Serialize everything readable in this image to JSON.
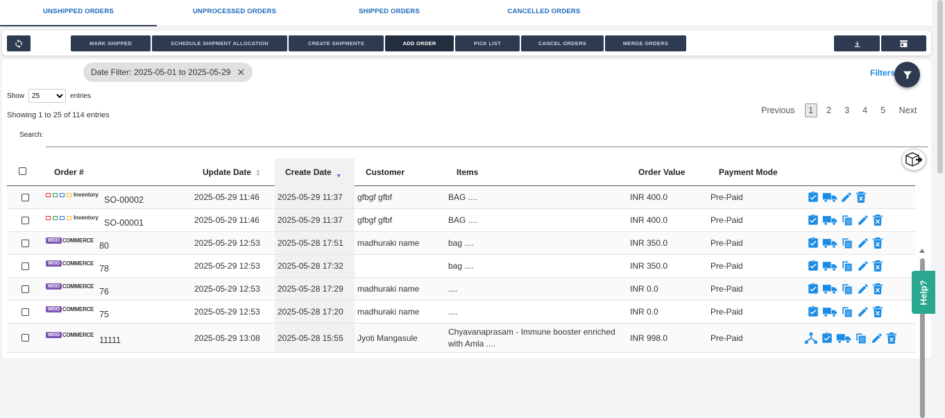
{
  "tabs": [
    {
      "label": "UNSHIPPED ORDERS",
      "active": true
    },
    {
      "label": "UNPROCESSED ORDERS",
      "active": false
    },
    {
      "label": "SHIPPED ORDERS",
      "active": false
    },
    {
      "label": "CANCELLED ORDERS",
      "active": false
    }
  ],
  "toolbar": {
    "refresh_icon": "refresh-icon",
    "buttons": [
      {
        "label": "MARK SHIPPED"
      },
      {
        "label": "SCHEDULE SHIPMENT ALLOCATION"
      },
      {
        "label": "CREATE SHIPMENTS"
      },
      {
        "label": "ADD ORDER"
      },
      {
        "label": "PICK LIST"
      },
      {
        "label": "CANCEL ORDERS"
      },
      {
        "label": "MERGE ORDERS"
      }
    ],
    "download_icon": "download-icon",
    "store_icon": "store-icon"
  },
  "filter": {
    "chip_text": "Date Filter: 2025-05-01 to 2025-05-29",
    "chip_close": "✕",
    "filters_label": "Filters"
  },
  "length": {
    "show": "Show",
    "value": "25",
    "entries": "entries",
    "options": [
      "25"
    ]
  },
  "info": "Showing 1 to 25 of 114 entries",
  "pager": {
    "previous": "Previous",
    "pages": [
      "1",
      "2",
      "3",
      "4",
      "5"
    ],
    "current": "1",
    "next": "Next"
  },
  "search": {
    "label": "Search:",
    "value": ""
  },
  "columns": {
    "order": "Order #",
    "update_date": "Update Date",
    "create_date": "Create Date",
    "customer": "Customer",
    "items": "Items",
    "order_value": "Order Value",
    "payment_mode": "Payment Mode"
  },
  "rows": [
    {
      "source": "inventory",
      "logo_text": "Inventory",
      "order": "SO-00002",
      "update": "2025-05-29 11:46",
      "create": "2025-05-29 11:37",
      "customer": "gfbgf gfbf",
      "items": "BAG ....",
      "value": "INR 400.0",
      "payment": "Pre-Paid",
      "actions": [
        "approve",
        "truck",
        "edit",
        "delete"
      ]
    },
    {
      "source": "inventory",
      "logo_text": "Inventory",
      "order": "SO-00001",
      "update": "2025-05-29 11:46",
      "create": "2025-05-29 11:37",
      "customer": "gfbgf gfbf",
      "items": "BAG ....",
      "value": "INR 400.0",
      "payment": "Pre-Paid",
      "actions": [
        "approve",
        "truck",
        "copy",
        "edit",
        "delete"
      ]
    },
    {
      "source": "woo",
      "logo_text": "WOOCOMMERCE",
      "order": "80",
      "update": "2025-05-29 12:53",
      "create": "2025-05-28 17:51",
      "customer": "madhuraki name",
      "items": "bag ....",
      "value": "INR 350.0",
      "payment": "Pre-Paid",
      "actions": [
        "approve",
        "truck",
        "copy",
        "edit",
        "delete"
      ]
    },
    {
      "source": "woo",
      "logo_text": "WOOCOMMERCE",
      "order": "78",
      "update": "2025-05-29 12:53",
      "create": "2025-05-28 17:32",
      "customer": "",
      "items": "bag ....",
      "value": "INR 350.0",
      "payment": "Pre-Paid",
      "actions": [
        "approve",
        "truck",
        "copy",
        "edit",
        "delete"
      ]
    },
    {
      "source": "woo",
      "logo_text": "WOOCOMMERCE",
      "order": "76",
      "update": "2025-05-29 12:53",
      "create": "2025-05-28 17:29",
      "customer": "madhuraki name",
      "items": "....",
      "value": "INR 0.0",
      "payment": "Pre-Paid",
      "actions": [
        "approve",
        "truck",
        "copy",
        "edit",
        "delete"
      ]
    },
    {
      "source": "woo",
      "logo_text": "WOOCOMMERCE",
      "order": "75",
      "update": "2025-05-29 12:53",
      "create": "2025-05-28 17:20",
      "customer": "madhuraki name",
      "items": "....",
      "value": "INR 0.0",
      "payment": "Pre-Paid",
      "actions": [
        "approve",
        "truck",
        "copy",
        "edit",
        "delete"
      ]
    },
    {
      "source": "woo",
      "logo_text": "WOOCOMMERCE",
      "order": "11111",
      "update": "2025-05-29 13:08",
      "create": "2025-05-28 15:55",
      "customer": "Jyoti Mangasule",
      "items": "Chyavanaprasam - Immune booster enriched with Amla ....",
      "value": "INR 998.0",
      "payment": "Pre-Paid",
      "actions": [
        "split",
        "approve",
        "truck",
        "copy",
        "edit",
        "delete"
      ]
    }
  ],
  "help": {
    "label": "Help?"
  },
  "colors": {
    "accent": "#1a8ce6",
    "dark": "#2d3a4f",
    "woo": "#7f54b3",
    "help": "#2aa88f"
  }
}
